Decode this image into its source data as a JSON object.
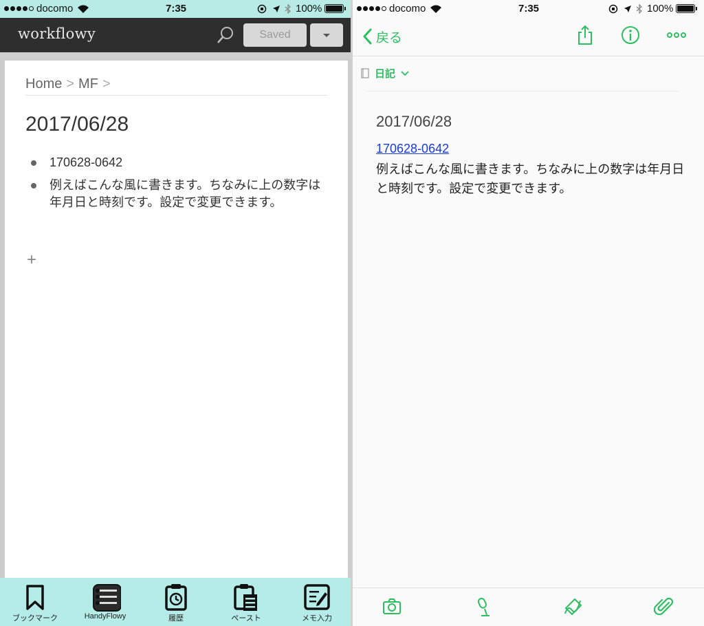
{
  "left_app": {
    "status": {
      "carrier": "docomo",
      "time": "7:35",
      "battery": "100%"
    },
    "header": {
      "logo": "workflowy",
      "saved_label": "Saved"
    },
    "breadcrumb": {
      "home": "Home",
      "sep": ">",
      "current": "MF",
      "tail": ">"
    },
    "title": "2017/06/28",
    "bullets": [
      {
        "text": "170628-0642"
      },
      {
        "text": "例えばこんな風に書きます。ちなみに上の数字は年月日と時刻です。設定で変更できます。"
      }
    ],
    "add_symbol": "+",
    "toolbar": [
      {
        "label": "ブックマーク",
        "icon": "bookmark-icon"
      },
      {
        "label": "HandyFlowy",
        "icon": "handyflowy-icon"
      },
      {
        "label": "履歴",
        "icon": "history-icon"
      },
      {
        "label": "ペースト",
        "icon": "paste-icon"
      },
      {
        "label": "メモ入力",
        "icon": "memo-input-icon"
      }
    ]
  },
  "right_app": {
    "status": {
      "carrier": "docomo",
      "time": "7:35",
      "battery": "100%"
    },
    "nav": {
      "back_label": "戻る"
    },
    "notebook": {
      "label": "日記"
    },
    "note": {
      "title": "2017/06/28",
      "link": "170628-0642",
      "body": "例えばこんな風に書きます。ちなみに上の数字は年月日と時刻です。設定で変更できます。"
    },
    "bottom_icons": [
      "camera-icon",
      "microphone-icon",
      "handwriting-icon",
      "attachment-icon"
    ]
  },
  "colors": {
    "workflowy_header": "#2e2e2e",
    "toolbar_bg": "#b5ece8",
    "evernote_green": "#2dbe60",
    "link_blue": "#1a3bd8"
  }
}
